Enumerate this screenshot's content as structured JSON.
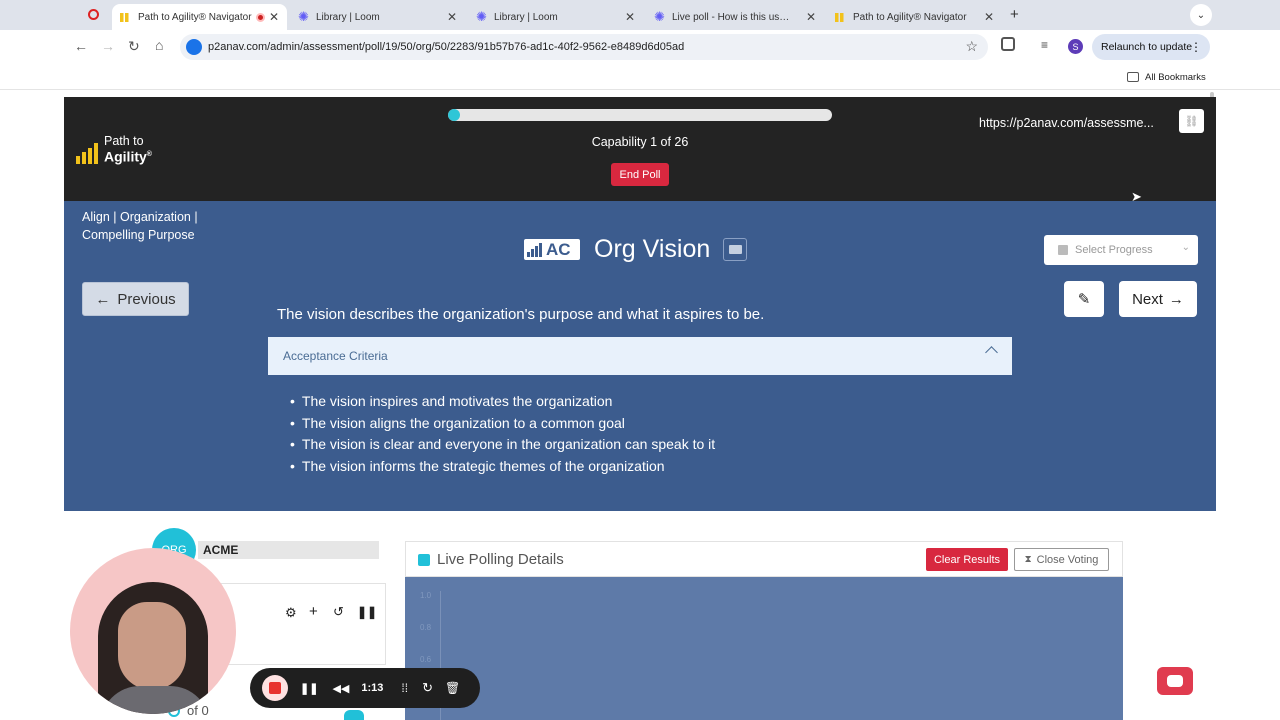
{
  "browser": {
    "tabs": [
      {
        "label": "Path to Agility® Navigator",
        "active": true
      },
      {
        "label": "Library | Loom",
        "active": false
      },
      {
        "label": "Library | Loom",
        "active": false
      },
      {
        "label": "Live poll - How is this used li",
        "active": false
      },
      {
        "label": "Path to Agility® Navigator",
        "active": false
      }
    ],
    "url": "p2anav.com/admin/assessment/poll/19/50/org/50/2283/91b57b76-ad1c-40f2-9562-e8489d6d05ad",
    "profile_initial": "S",
    "relaunch_label": "Relaunch to update",
    "bookmarks_label": "All Bookmarks"
  },
  "header": {
    "logo_line1": "Path to",
    "logo_line2": "Agility",
    "logo_reg": "®",
    "progress_fraction": 0.03,
    "capability_text": "Capability 1 of 26",
    "end_poll_label": "End Poll",
    "share_url": "https://p2anav.com/assessme..."
  },
  "capability": {
    "breadcrumb_line1": "Align | Organization |",
    "breadcrumb_line2": "Compelling Purpose",
    "badge_text": "AC",
    "title": "Org Vision",
    "select_progress_placeholder": "Select Progress",
    "previous_label": "Previous",
    "next_label": "Next",
    "description": "The vision describes the organization's purpose and what it aspires to be.",
    "acceptance_label": "Acceptance Criteria",
    "criteria": [
      "The vision inspires and motivates the organization",
      "The vision aligns the organization to a common goal",
      "The vision is clear and everyone in the organization can speak to it",
      "The vision informs the strategic themes of the organization"
    ]
  },
  "org": {
    "avatar_text": "ORG",
    "name": "ACME",
    "of_text": "of 0"
  },
  "polling": {
    "title": "Live Polling Details",
    "clear_label": "Clear Results",
    "close_label": "Close Voting",
    "y_ticks": [
      "1.0",
      "0.8",
      "0.6"
    ]
  },
  "recorder": {
    "time": "1:13"
  },
  "colors": {
    "header_bg": "#232323",
    "section_blue": "#3c5c8e",
    "accent_red": "#d8283f",
    "progress_teal": "#2ec6d7"
  }
}
